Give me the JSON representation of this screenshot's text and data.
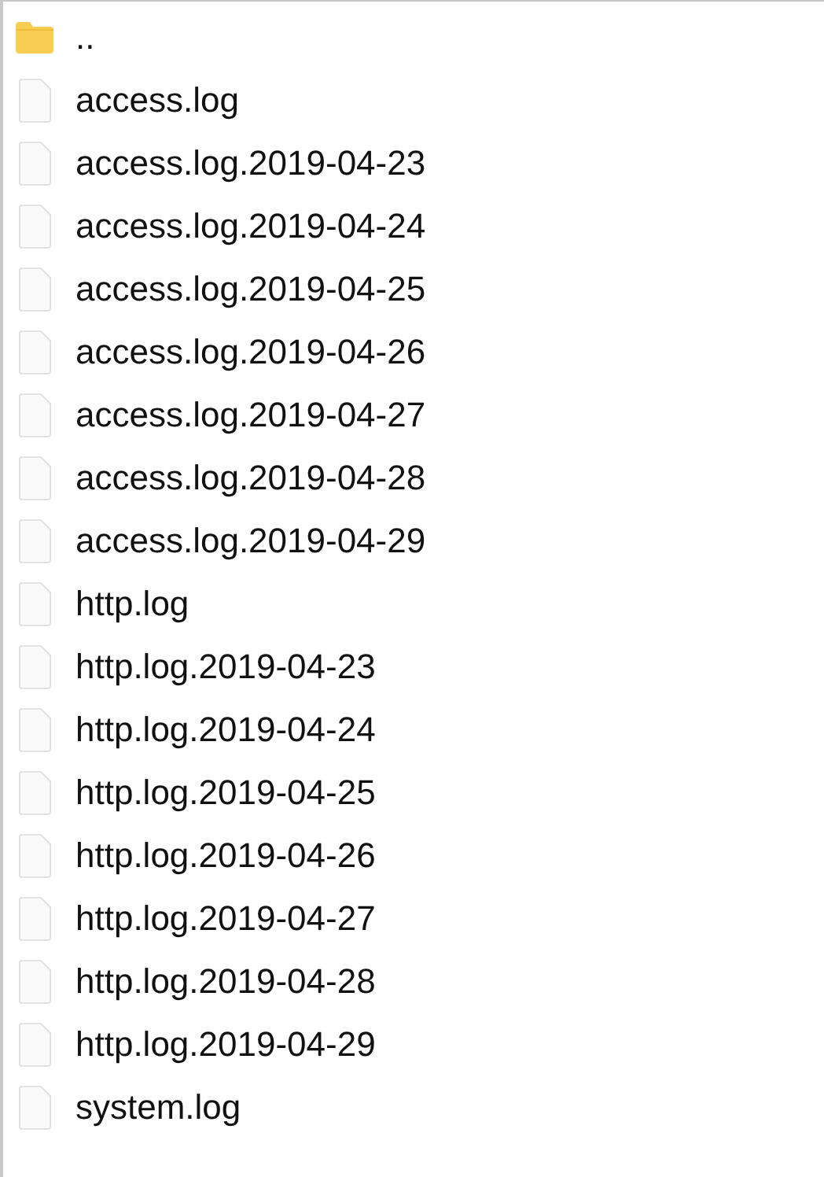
{
  "files": [
    {
      "name": "..",
      "kind": "folder"
    },
    {
      "name": "access.log",
      "kind": "file"
    },
    {
      "name": "access.log.2019-04-23",
      "kind": "file"
    },
    {
      "name": "access.log.2019-04-24",
      "kind": "file"
    },
    {
      "name": "access.log.2019-04-25",
      "kind": "file"
    },
    {
      "name": "access.log.2019-04-26",
      "kind": "file"
    },
    {
      "name": "access.log.2019-04-27",
      "kind": "file"
    },
    {
      "name": "access.log.2019-04-28",
      "kind": "file"
    },
    {
      "name": "access.log.2019-04-29",
      "kind": "file"
    },
    {
      "name": "http.log",
      "kind": "file"
    },
    {
      "name": "http.log.2019-04-23",
      "kind": "file"
    },
    {
      "name": "http.log.2019-04-24",
      "kind": "file"
    },
    {
      "name": "http.log.2019-04-25",
      "kind": "file"
    },
    {
      "name": "http.log.2019-04-26",
      "kind": "file"
    },
    {
      "name": "http.log.2019-04-27",
      "kind": "file"
    },
    {
      "name": "http.log.2019-04-28",
      "kind": "file"
    },
    {
      "name": "http.log.2019-04-29",
      "kind": "file"
    },
    {
      "name": "system.log",
      "kind": "file"
    }
  ]
}
